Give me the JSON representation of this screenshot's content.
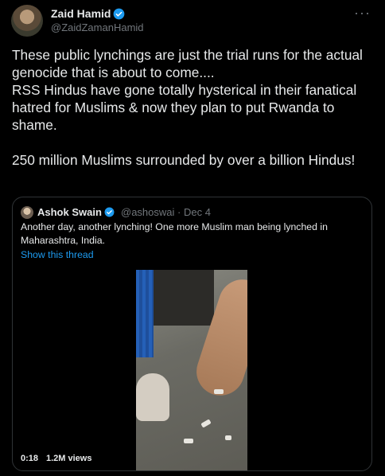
{
  "author": {
    "name": "Zaid Hamid",
    "handle": "@ZaidZamanHamid",
    "verified_icon": "verified-badge-icon",
    "avatar_icon": "avatar"
  },
  "more_icon": "···",
  "tweet": {
    "text": "These public lynchings are just the trial runs for the actual genocide that is about to come....\nRSS Hindus have gone totally hysterical in their fanatical hatred for Muslims & now they plan to put Rwanda to shame.\n\n250 million Muslims surrounded by over a billion Hindus!"
  },
  "quoted": {
    "name": "Ashok Swain",
    "handle": "@ashoswai",
    "separator": "·",
    "date": "Dec 4",
    "text": "Another day, another lynching! One more Muslim man being lynched in Maharashtra, India.",
    "show_thread": "Show this thread",
    "video": {
      "time": "0:18",
      "views": "1.2M views"
    }
  },
  "colors": {
    "background": "#000000",
    "text": "#e7e9ea",
    "muted": "#71767b",
    "link": "#1d9bf0",
    "border": "#2f3336"
  }
}
